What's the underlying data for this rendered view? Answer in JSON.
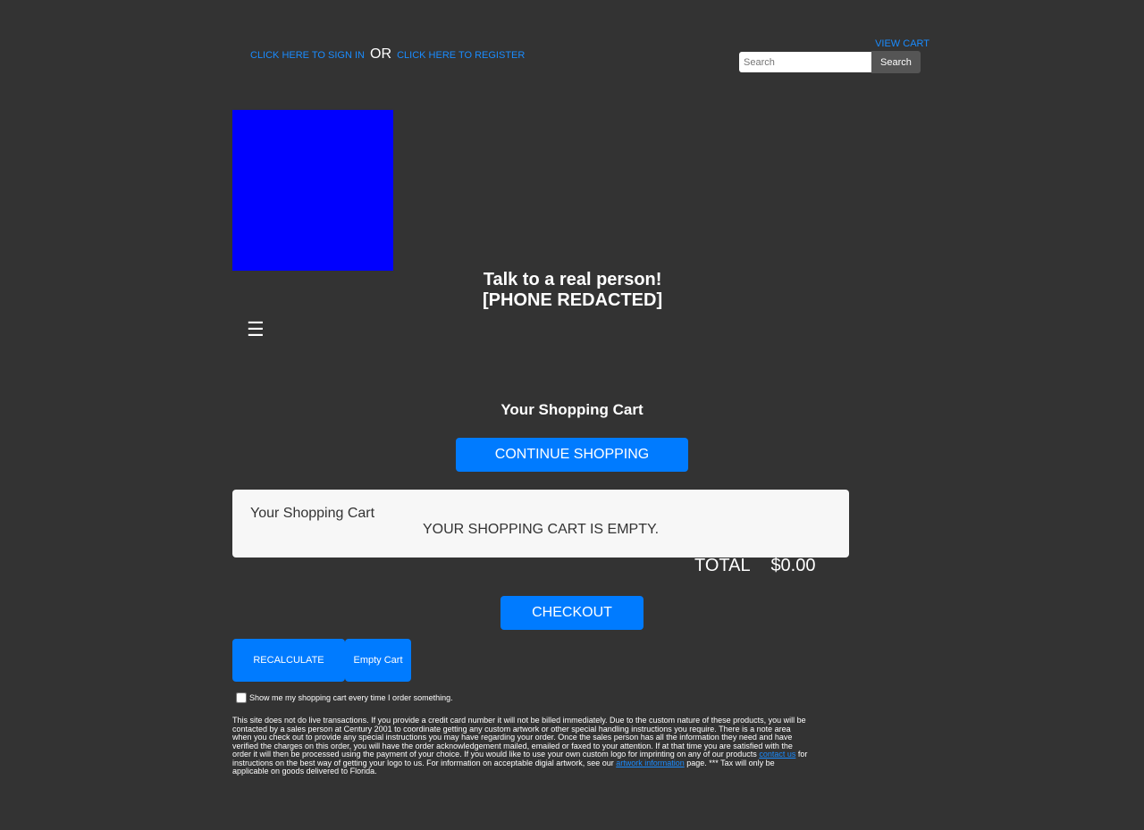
{
  "header": {
    "sign_in_link": "CLICK HERE TO SIGN IN",
    "or_text": "OR",
    "register_link": "CLICK HERE TO REGISTER",
    "view_cart_link": "VIEW CART",
    "search_placeholder": "Search",
    "search_button": "Search"
  },
  "branding": {
    "logo_color": "#0000ff",
    "talk_line1": "Talk to a real person!",
    "talk_line2": "[PHONE REDACTED]",
    "menu_icon": "☰"
  },
  "cart": {
    "page_title": "Your Shopping Cart",
    "continue_button": "CONTINUE SHOPPING",
    "box_header": "Your Shopping Cart",
    "empty_message": "YOUR SHOPPING CART IS EMPTY.",
    "total_label": "TOTAL",
    "total_value": "$0.00",
    "checkout_button": "CHECKOUT",
    "recalculate_button": "RECALCULATE",
    "empty_cart_button": "Empty Cart",
    "show_cart_label": "Show me my shopping cart every time I order something."
  },
  "disclaimer": {
    "part1": "This site does not do live transactions. If you provide a credit card number it will not be billed immediately. Due to the custom nature of these products, you will be contacted by a sales person at Century 2001 to coordinate getting any custom artwork or other special handling instructions you require. There is a note area when you check out to provide any special instructions you may have regarding your order. Once the sales person has all the information they need and have verified the charges on this order, you will have the order acknowledgement mailed, emailed or faxed to your attention. If at that time you are satisfied with the order it will then be processed using the payment of your choice. If you would like to use your own custom logo for imprinting on any of our products ",
    "contact_link": "contact us",
    "part2": " for instructions on the best way of getting your logo to us. For information on acceptable digial artwork, see our ",
    "artwork_link": "artwork information",
    "part3": " page. *** Tax will only be applicable on goods delivered to Florida."
  },
  "colors": {
    "background": "#333333",
    "link": "#1a8cff",
    "button_primary": "#007bff"
  }
}
